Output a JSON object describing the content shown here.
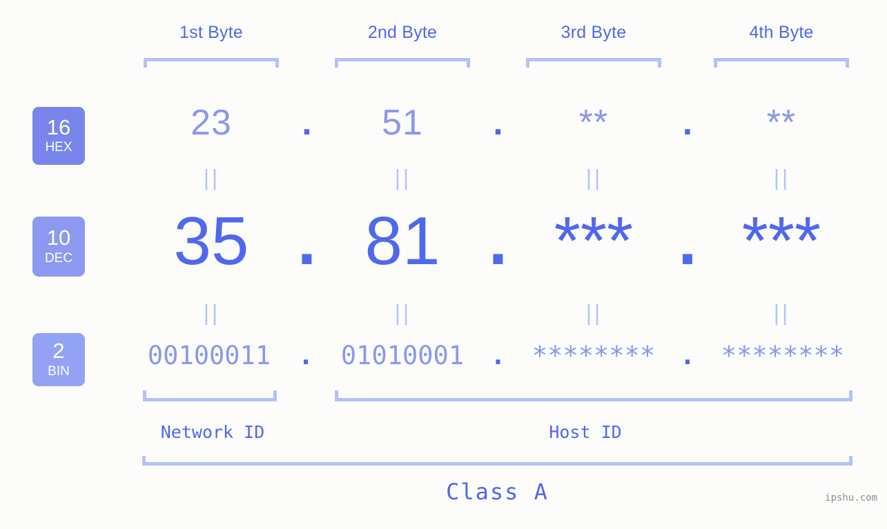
{
  "meta": {
    "background_color": "#fcfdfa",
    "accent_strong": "#5068ee",
    "accent_mid": "#8b97f0",
    "accent_light": "#b6c1f9",
    "watermark": "ipshu.com"
  },
  "byte_headers": [
    {
      "label": "1st Byte"
    },
    {
      "label": "2nd Byte"
    },
    {
      "label": "3rd Byte"
    },
    {
      "label": "4th Byte"
    }
  ],
  "bases": [
    {
      "num": "16",
      "abbr": "HEX",
      "color": "#7886ec"
    },
    {
      "num": "10",
      "abbr": "DEC",
      "color": "#8b99f1"
    },
    {
      "num": "2",
      "abbr": "BIN",
      "color": "#92a3f5"
    }
  ],
  "rows": {
    "hex": {
      "values": [
        "23",
        "51",
        "**",
        "**"
      ],
      "separators": [
        ".",
        ".",
        "."
      ]
    },
    "dec": {
      "values": [
        "35",
        "81",
        "***",
        "***"
      ],
      "separators": [
        ".",
        ".",
        "."
      ]
    },
    "bin": {
      "values": [
        "00100011",
        "01010001",
        "********",
        "********"
      ],
      "separators": [
        ".",
        ".",
        "."
      ]
    }
  },
  "equality_marks": {
    "symbol": "||",
    "row1": [
      "||",
      "||",
      "||",
      "||"
    ],
    "row2": [
      "||",
      "||",
      "||",
      "||"
    ]
  },
  "id_sections": [
    {
      "label": "Network ID"
    },
    {
      "label": "Host ID"
    }
  ],
  "class": {
    "label": "Class A"
  }
}
